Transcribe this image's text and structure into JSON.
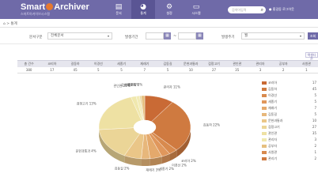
{
  "app": {
    "logo_text_a": "Smart",
    "logo_text_b": "Archiver",
    "subtitle": "스마트아카이브시스템"
  },
  "menu": [
    {
      "icon": "▤",
      "label": "문서"
    },
    {
      "icon": "◕",
      "label": "통계"
    },
    {
      "icon": "⚙",
      "label": "설정"
    },
    {
      "icon": "▭",
      "label": "시스템"
    }
  ],
  "search": {
    "placeholder": "검색어입력"
  },
  "user": {
    "name": "홍길동",
    "action": "로그아웃"
  },
  "breadcrumb": "⌂  >  통계",
  "filters": {
    "label1": "문서구분",
    "select1": "전체문서",
    "label2": "발생기간",
    "tilde": "~",
    "label3": "발생주기",
    "select3": "월",
    "search_button": "조회"
  },
  "export_button": "엑셀다운",
  "table": {
    "headers": [
      "총 건수",
      "코리아",
      "길동하",
      "이경선",
      "세종기",
      "재래기",
      "김동길",
      "문헌과통과",
      "검정고기",
      "관인관",
      "관리자",
      "공부자",
      "사원관"
    ],
    "values": [
      "380",
      "17",
      "45",
      "5",
      "5",
      "7",
      "5",
      "10",
      "27",
      "35",
      "3",
      "2",
      "1"
    ]
  },
  "chart_data": {
    "type": "pie",
    "categories": [
      "관리자",
      "김동하",
      "코리아",
      "이경선",
      "세종기",
      "재래기",
      "김동길",
      "문헌과통과",
      "검정고기",
      "관인관",
      "공부자",
      "사원관",
      "관리기"
    ],
    "values": [
      17,
      45,
      5,
      5,
      7,
      5,
      10,
      27,
      35,
      3,
      2,
      1,
      2
    ],
    "colors": [
      "#c96a35",
      "#cf7a40",
      "#d88a4e",
      "#e0975c",
      "#e4a96c",
      "#e7b77b",
      "#eac688",
      "#ebd597",
      "#eee1a3",
      "#f0e8ae",
      "#f2ebb6",
      "#ead69b",
      "#e6c07f"
    ],
    "slice_labels": [
      "관리자 11%",
      "김동하 22%",
      "코리아 2%",
      "이경선 2%",
      "세종기 2%",
      "재래기 3%",
      "김동길 2%",
      "문헌과통과 4%",
      "검정고기 13%",
      "관인관 21%",
      "공부자 1%",
      "사원관 1%",
      "관리기 2%"
    ]
  },
  "legend": [
    {
      "name": "코리아",
      "value": "17",
      "color": "#c96a35"
    },
    {
      "name": "김동하",
      "value": "45",
      "color": "#cf7a40"
    },
    {
      "name": "이경선",
      "value": "5",
      "color": "#d88a4e"
    },
    {
      "name": "세종기",
      "value": "5",
      "color": "#e0975c"
    },
    {
      "name": "재래기",
      "value": "7",
      "color": "#e4a96c"
    },
    {
      "name": "김동길",
      "value": "5",
      "color": "#e7b77b"
    },
    {
      "name": "문헌과통과",
      "value": "10",
      "color": "#eac688"
    },
    {
      "name": "검정고기",
      "value": "27",
      "color": "#ebd597"
    },
    {
      "name": "관인관",
      "value": "35",
      "color": "#eee1a3"
    },
    {
      "name": "관리자",
      "value": "3",
      "color": "#f0e8ae"
    },
    {
      "name": "공부자",
      "value": "2",
      "color": "#e6c07f"
    },
    {
      "name": "사원관",
      "value": "1",
      "color": "#d88a4e"
    },
    {
      "name": "관리기",
      "value": "2",
      "color": "#cf7a40"
    }
  ]
}
